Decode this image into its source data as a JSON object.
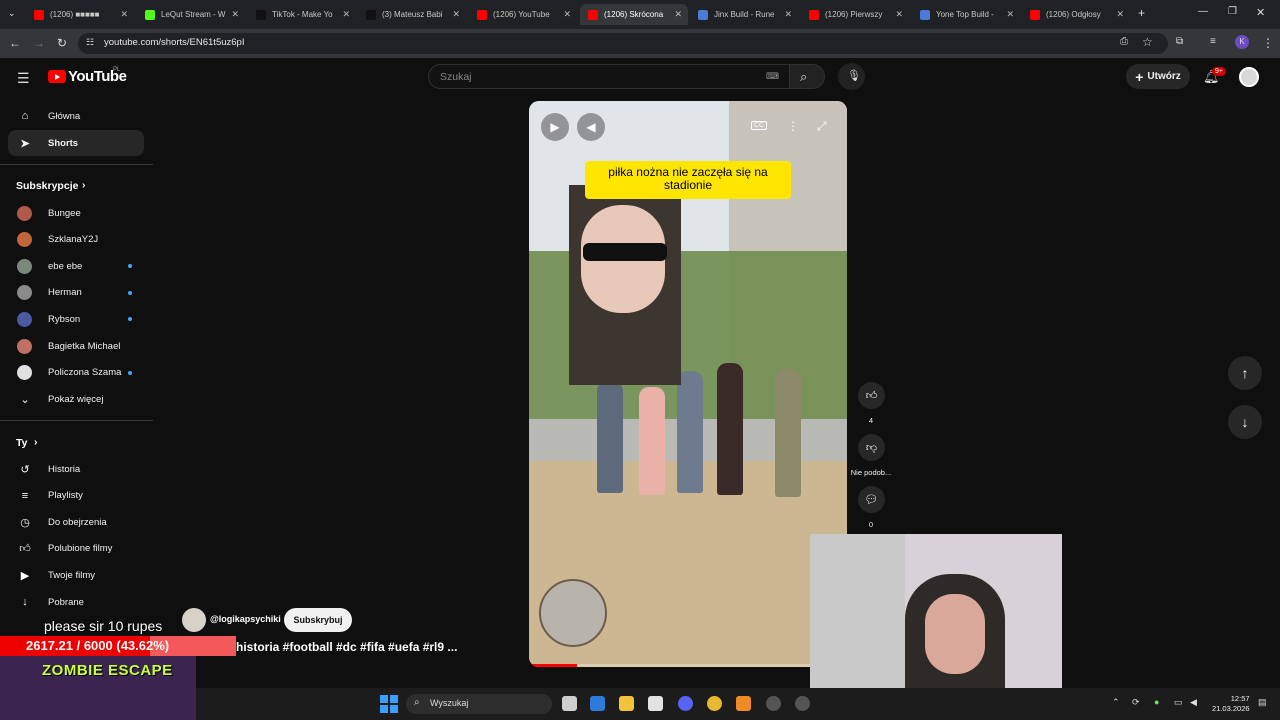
{
  "browser": {
    "tabs": [
      {
        "title": "(1206) ■■■■■",
        "color": "#ff0000"
      },
      {
        "title": "LeQut Stream - W",
        "color": "#53fc18"
      },
      {
        "title": "TikTok - Make Yo",
        "color": "#111111"
      },
      {
        "title": "(3) Mateusz Babi",
        "color": "#111111"
      },
      {
        "title": "(1206) YouTube",
        "color": "#ff0000"
      },
      {
        "title": "(1206) Skrócona",
        "color": "#ff0000"
      },
      {
        "title": "Jinx Build - Rune",
        "color": "#4a7bd8"
      },
      {
        "title": "(1206) Pierwszy",
        "color": "#ff0000"
      },
      {
        "title": "Yone Top Build -",
        "color": "#4a7bd8"
      },
      {
        "title": "(1206) Odgłosy",
        "color": "#ff0000"
      }
    ],
    "url": "youtube.com/shorts/EN61t5uz6pI",
    "profile_initial": "K"
  },
  "header": {
    "logo": "YouTube",
    "country": "PL",
    "search_placeholder": "Szukaj",
    "create_label": "Utwórz",
    "notif_badge": "9+"
  },
  "sidebar": {
    "main": [
      {
        "label": "Główna",
        "icon": "home-icon"
      },
      {
        "label": "Shorts",
        "icon": "shorts-icon"
      }
    ],
    "subs_heading": "Subskrypcje",
    "channels": [
      {
        "name": "Bungee",
        "color": "#b05a4a",
        "dot": false
      },
      {
        "name": "SzklanaY2J",
        "color": "#c0663a",
        "dot": false
      },
      {
        "name": "ebe ebe",
        "color": "#7a8a7a",
        "dot": true
      },
      {
        "name": "Herman",
        "color": "#8a8a8a",
        "dot": true
      },
      {
        "name": "Rybson",
        "color": "#4a5aa0",
        "dot": true
      },
      {
        "name": "Bagietka Michael",
        "color": "#c07060",
        "dot": false
      },
      {
        "name": "Policzona Szama",
        "color": "#e0e0e0",
        "dot": true
      }
    ],
    "show_more": "Pokaż więcej",
    "you_heading": "Ty",
    "you_items": [
      {
        "label": "Historia",
        "icon": "history-icon"
      },
      {
        "label": "Playlisty",
        "icon": "playlist-icon"
      },
      {
        "label": "Do obejrzenia",
        "icon": "watch-later-icon"
      },
      {
        "label": "Polubione filmy",
        "icon": "like-icon"
      },
      {
        "label": "Twoje filmy",
        "icon": "video-icon"
      },
      {
        "label": "Pobrane",
        "icon": "download-icon"
      }
    ],
    "truncated": "Pokaż więcej"
  },
  "short": {
    "caption": "piłka nożna nie zaczęła się na stadionie",
    "progress": 0.15,
    "like_count": "4",
    "dislike_label": "Nie podob...",
    "comment_count": "0",
    "channel": "@logikapsychiki",
    "subscribe_label": "Subskrybuj",
    "title": "historia #football #dc #fifa #uefa #rl9 ..."
  },
  "stream_overlay": {
    "message": "please sir 10 rupes",
    "counter": "2617.21 / 6000 (43.62%)",
    "game": "ZOMBIE ESCAPE"
  },
  "taskbar": {
    "search": "Wyszukaj",
    "time": "12:57",
    "date": "21.03.2026"
  }
}
